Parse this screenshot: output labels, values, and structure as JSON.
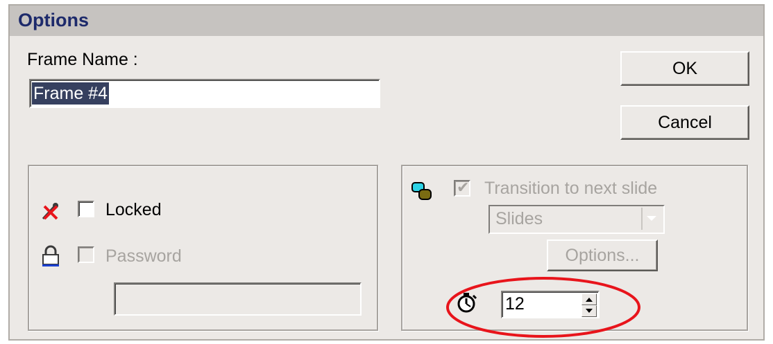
{
  "dialog": {
    "title": "Options",
    "frame_name_label": "Frame Name :",
    "frame_name_value": "Frame #4",
    "ok_label": "OK",
    "cancel_label": "Cancel"
  },
  "left_group": {
    "locked_label": "Locked",
    "locked_checked": false,
    "locked_icon": "pin-cross-icon",
    "password_label": "Password",
    "password_checked": false,
    "password_enabled": false,
    "password_icon": "lock-icon",
    "password_value": ""
  },
  "right_group": {
    "transition_icon": "shapes-icon",
    "transition_label": "Transition to next slide",
    "transition_checked": true,
    "transition_enabled": false,
    "transition_type": "Slides",
    "options_label": "Options...",
    "timer_icon": "stopwatch-icon",
    "timer_value": "12"
  },
  "annotation": {
    "highlight_color": "#e8141b"
  }
}
